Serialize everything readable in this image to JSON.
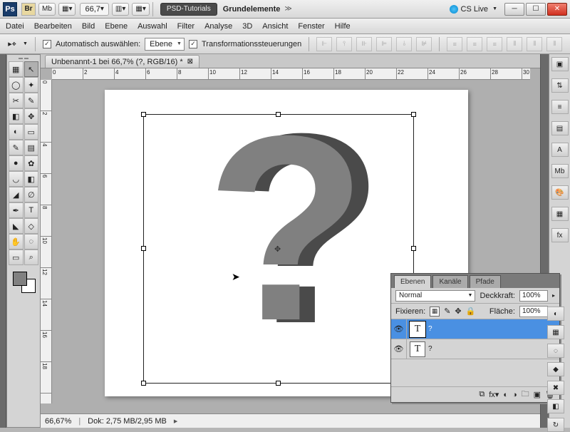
{
  "titlebar": {
    "zoom": "66,7",
    "workspace_psd": "PSD-Tutorials",
    "workspace_grund": "Grundelemente",
    "cslive": "CS Live",
    "mb": "Mb"
  },
  "menu": [
    "Datei",
    "Bearbeiten",
    "Bild",
    "Ebene",
    "Auswahl",
    "Filter",
    "Analyse",
    "3D",
    "Ansicht",
    "Fenster",
    "Hilfe"
  ],
  "options": {
    "auto_select": "Automatisch auswählen:",
    "layer_type": "Ebene",
    "transform": "Transformationssteuerungen"
  },
  "doc": {
    "tab": "Unbenannt-1 bei 66,7% (?, RGB/16) *",
    "status_zoom": "66,67%",
    "status_doc": "Dok: 2,75 MB/2,95 MB"
  },
  "rulerH": [
    "0",
    "2",
    "4",
    "6",
    "8",
    "10",
    "12",
    "14",
    "16",
    "18",
    "20",
    "22",
    "24",
    "26",
    "28",
    "30"
  ],
  "rulerV": [
    "0",
    "2",
    "4",
    "6",
    "8",
    "10",
    "12",
    "14",
    "16",
    "18"
  ],
  "layers": {
    "tabs": [
      "Ebenen",
      "Kanäle",
      "Pfade"
    ],
    "blend": "Normal",
    "opacity_label": "Deckkraft:",
    "opacity": "100%",
    "lock_label": "Fixieren:",
    "fill_label": "Fläche:",
    "fill": "100%",
    "items": [
      {
        "name": "?",
        "type": "T",
        "selected": true
      },
      {
        "name": "?",
        "type": "T",
        "selected": false
      }
    ]
  },
  "tools": [
    [
      "▦",
      "↖"
    ],
    [
      "◯",
      "✦"
    ],
    [
      "✂",
      "✎"
    ],
    [
      "◧",
      "✥"
    ],
    [
      "◐",
      "▭"
    ],
    [
      "✎",
      "▤"
    ],
    [
      "●",
      "✿"
    ],
    [
      "◡",
      "◧"
    ],
    [
      "◢",
      "∅"
    ],
    [
      "✒",
      "T"
    ],
    [
      "◣",
      "◇"
    ],
    [
      "✋",
      "◌"
    ],
    [
      "▭",
      "⌕"
    ]
  ],
  "right_icons": [
    "▣",
    "⇅",
    "≡",
    "▤",
    "A",
    "Mb",
    "🎨",
    "▦",
    "fx"
  ],
  "right_icons2": [
    "◐",
    "▦",
    "◌",
    "◆",
    "✖",
    "◧",
    "↻"
  ]
}
